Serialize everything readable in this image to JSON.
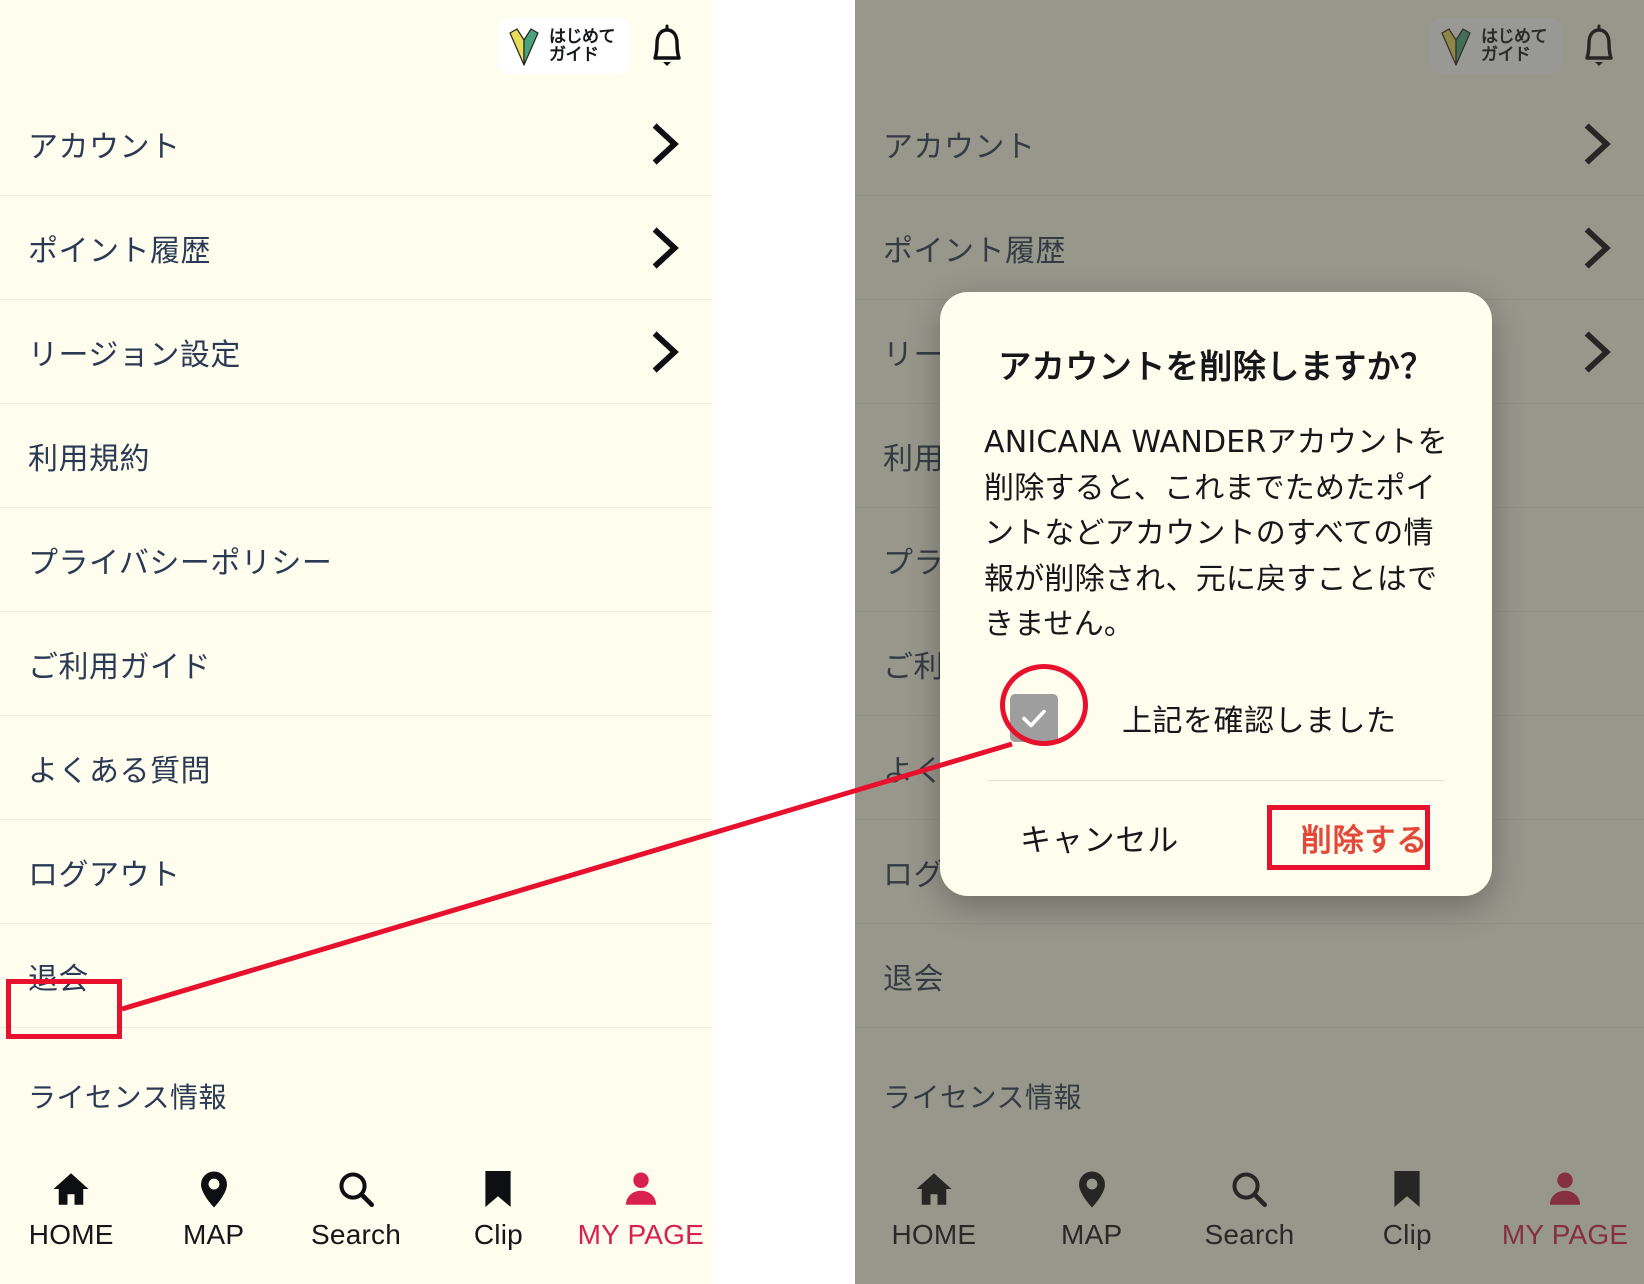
{
  "app": {
    "name": "ANICANA WANDER",
    "background_color": "#fffdee",
    "text_color": "#2b3a54",
    "accent_color": "#d9214f",
    "danger_color": "#e2493a",
    "annotation_color": "#e8112d"
  },
  "header": {
    "guide_badge": {
      "line1": "はじめて",
      "line2": "ガイド",
      "icon": "shoshinsha-leaf-icon"
    },
    "notification_icon": "bell-icon"
  },
  "menu": {
    "items": [
      {
        "label": "アカウント",
        "chevron": true
      },
      {
        "label": "ポイント履歴",
        "chevron": true
      },
      {
        "label": "リージョン設定",
        "chevron": true
      },
      {
        "label": "利用規約",
        "chevron": false
      },
      {
        "label": "プライバシーポリシー",
        "chevron": false
      },
      {
        "label": "ご利用ガイド",
        "chevron": false
      },
      {
        "label": "よくある質問",
        "chevron": false
      },
      {
        "label": "ログアウト",
        "chevron": false
      },
      {
        "label": "退会",
        "chevron": false
      }
    ],
    "license_label": "ライセンス情報"
  },
  "bottom_nav": {
    "items": [
      {
        "label": "HOME",
        "icon": "home-icon",
        "active": false
      },
      {
        "label": "MAP",
        "icon": "map-pin-icon",
        "active": false
      },
      {
        "label": "Search",
        "icon": "search-icon",
        "active": false
      },
      {
        "label": "Clip",
        "icon": "bookmark-icon",
        "active": false
      },
      {
        "label": "MY PAGE",
        "icon": "person-icon",
        "active": true
      }
    ]
  },
  "dialog": {
    "title": "アカウントを削除しますか？",
    "body": "ANICANA WANDERアカウントを削除すると、これまでためたポイントなどアカウントのすべての情報が削除され、元に戻すことはできません。",
    "checkbox": {
      "label": "上記を確認しました",
      "checked": true,
      "state_color": "#9e9e9e"
    },
    "cancel_label": "キャンセル",
    "delete_label": "削除する"
  },
  "annotations": {
    "withdraw_box_target": "退会",
    "checkbox_circle_target": "上記を確認しました",
    "delete_box_target": "削除する",
    "connector": "line from 退会 to checkbox"
  }
}
